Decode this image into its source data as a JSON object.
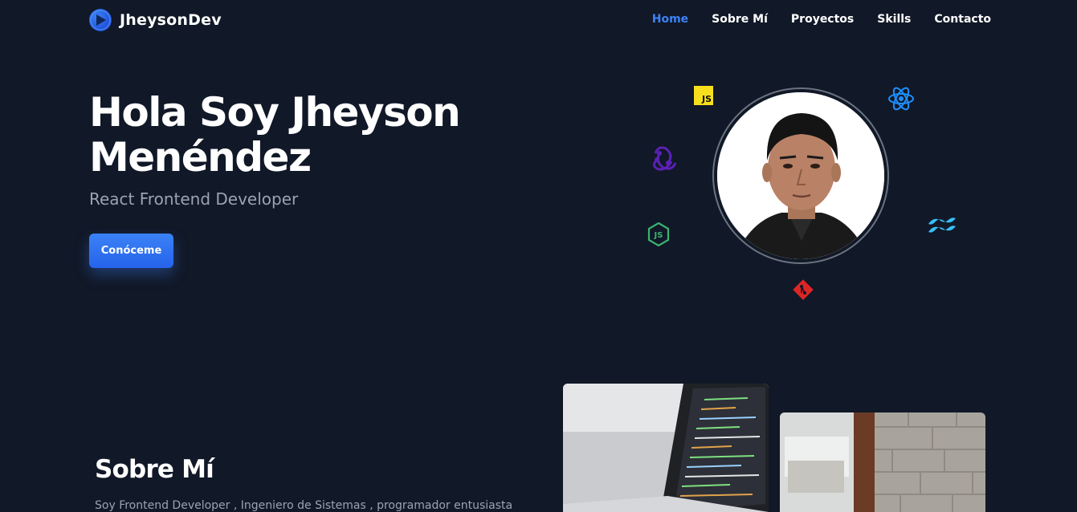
{
  "nav": {
    "brand": "JheysonDev",
    "links": [
      {
        "label": "Home",
        "active": true
      },
      {
        "label": "Sobre Mí",
        "active": false
      },
      {
        "label": "Proyectos",
        "active": false
      },
      {
        "label": "Skills",
        "active": false
      },
      {
        "label": "Contacto",
        "active": false
      }
    ]
  },
  "hero": {
    "title_line1": "Hola Soy Jheyson",
    "title_line2": "Menéndez",
    "subtitle": "React Frontend Developer",
    "cta_label": "Conóceme"
  },
  "skills_orbit": {
    "js_label": "JS",
    "icons": [
      "javascript-icon",
      "react-icon",
      "redux-icon",
      "nodejs-icon",
      "tailwind-icon",
      "git-icon"
    ]
  },
  "about": {
    "title": "Sobre Mí",
    "text": "Soy Frontend Developer , Ingeniero de Sistemas , programador entusiasta"
  },
  "colors": {
    "background": "#111827",
    "accent": "#3b82f6",
    "muted_text": "#9ca3af"
  }
}
